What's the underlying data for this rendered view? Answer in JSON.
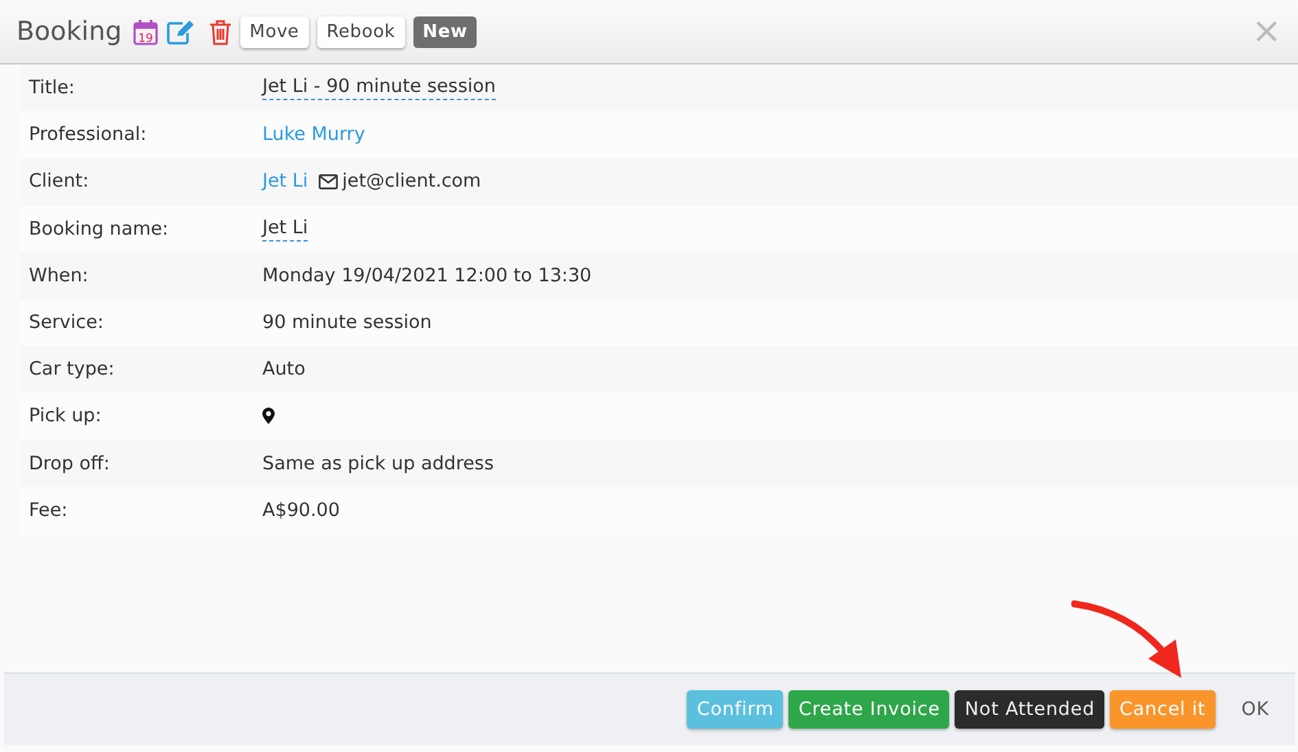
{
  "header": {
    "title": "Booking",
    "calendar_day": "19",
    "buttons": [
      {
        "label": "Move",
        "kind": "plain"
      },
      {
        "label": "Rebook",
        "kind": "plain"
      },
      {
        "label": "New",
        "kind": "badge"
      }
    ],
    "close": "×"
  },
  "details": [
    {
      "label": "Title:",
      "kind": "editable",
      "value": "Jet Li - 90 minute session"
    },
    {
      "label": "Professional:",
      "kind": "link",
      "value": "Luke Murry"
    },
    {
      "label": "Client:",
      "kind": "client",
      "value": "Jet Li",
      "email": "jet@client.com"
    },
    {
      "label": "Booking name:",
      "kind": "editable",
      "value": "Jet Li"
    },
    {
      "label": "When:",
      "kind": "plain",
      "value": "Monday 19/04/2021 12:00 to 13:30"
    },
    {
      "label": "Service:",
      "kind": "plain",
      "value": "90 minute session"
    },
    {
      "label": "Car type:",
      "kind": "plain",
      "value": "Auto"
    },
    {
      "label": "Pick up:",
      "kind": "location"
    },
    {
      "label": "Drop off:",
      "kind": "plain",
      "value": "Same as pick up address"
    },
    {
      "label": "Fee:",
      "kind": "plain",
      "value": "A$90.00"
    }
  ],
  "footer": {
    "buttons": [
      {
        "label": "Confirm",
        "kind": "info"
      },
      {
        "label": "Create Invoice",
        "kind": "success"
      },
      {
        "label": "Not Attended",
        "kind": "dark"
      },
      {
        "label": "Cancel it",
        "kind": "warning"
      },
      {
        "label": "OK",
        "kind": "link"
      }
    ]
  }
}
